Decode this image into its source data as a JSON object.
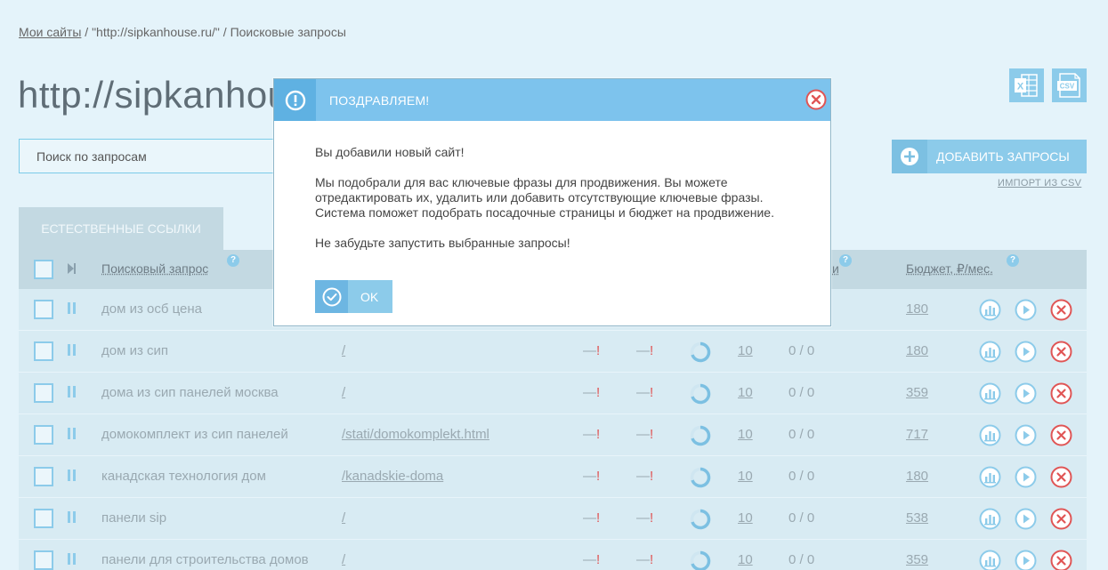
{
  "breadcrumb": {
    "my_sites": "Мои сайты",
    "sep1": " / ",
    "site": "\"http://sipkanhouse.ru/\"",
    "sep2": " / ",
    "current": "Поисковые запросы"
  },
  "page_title": "http://sipkanhouse.ru/",
  "export": {
    "excel_icon": "excel-icon",
    "csv_icon": "csv-icon",
    "csv_text": "CSV"
  },
  "search": {
    "placeholder": "Поиск по запросам",
    "value": "Поиск по запросам"
  },
  "add_button": {
    "label": "ДОБАВИТЬ ЗАПРОСЫ",
    "icon": "plus-circle-icon"
  },
  "import_link": "ИМПОРТ ИЗ CSV",
  "tabs": [
    {
      "label": "ЕСТЕСТВЕННЫЕ ССЫЛКИ"
    }
  ],
  "table": {
    "headers": {
      "query": "Поисковый запрос",
      "hidden_tail": "и",
      "budget": "Бюджет, ₽/мес."
    },
    "help_mark": "?",
    "rows": [
      {
        "query": "дом из осб цена",
        "page": "",
        "pos1": "",
        "pos2": "",
        "count": "",
        "ratio": "",
        "budget": "180"
      },
      {
        "query": "дом из сип",
        "page": "/",
        "pos1": "—",
        "pos2": "—",
        "count": "10",
        "ratio": "0 / 0",
        "budget": "180"
      },
      {
        "query": "дома из сип панелей москва",
        "page": "/",
        "pos1": "—",
        "pos2": "—",
        "count": "10",
        "ratio": "0 / 0",
        "budget": "359"
      },
      {
        "query": "домокомплект из сип панелей",
        "page": "/stati/domokomplekt.html",
        "pos1": "—",
        "pos2": "—",
        "count": "10",
        "ratio": "0 / 0",
        "budget": "717"
      },
      {
        "query": "канадская технология дом",
        "page": "/kanadskie-doma",
        "pos1": "—",
        "pos2": "—",
        "count": "10",
        "ratio": "0 / 0",
        "budget": "180"
      },
      {
        "query": "панели sip",
        "page": "/",
        "pos1": "—",
        "pos2": "—",
        "count": "10",
        "ratio": "0 / 0",
        "budget": "538"
      },
      {
        "query": "панели для строительства домов",
        "page": "/",
        "pos1": "—",
        "pos2": "—",
        "count": "10",
        "ratio": "0 / 0",
        "budget": "359"
      }
    ],
    "warn_mark": "!"
  },
  "modal": {
    "title": "ПОЗДРАВЛЯЕМ!",
    "p1": "Вы добавили новый сайт!",
    "p2": "Мы подобрали для вас ключевые фразы для продвижения. Вы можете отредактировать их, удалить или добавить отсутствующие ключевые фразы. Система поможет подобрать посадочные страницы и бюджет на продвижение.",
    "p3": "Не забудьте запустить выбранные запросы!",
    "ok_label": "OK"
  },
  "colors": {
    "background": "#e4f3fa",
    "accent": "#8ccbea",
    "modal_header": "#7dc3ed",
    "danger": "#e05555"
  }
}
